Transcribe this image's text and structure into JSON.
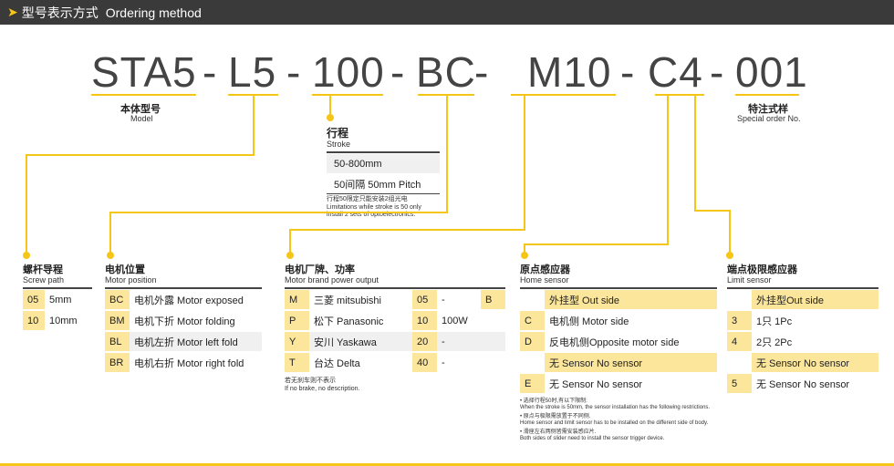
{
  "header": {
    "title_zh": "型号表示方式",
    "title_en": "Ordering method"
  },
  "code": {
    "p1": "STA5",
    "s1": "-",
    "p2": "L5",
    "s2": "-",
    "p3": "100",
    "s3": "-",
    "p4": "BC",
    "s4": "-",
    "p5": "M10",
    "s5": "-",
    "p6": "C4",
    "s6": "-",
    "p7": "001"
  },
  "model": {
    "zh": "本体型号",
    "en": "Model"
  },
  "special": {
    "zh": "特注式样",
    "en": "Special order No."
  },
  "stroke": {
    "zh": "行程",
    "en": "Stroke",
    "rows": [
      "50-800mm",
      "50间隔 50mm Pitch"
    ],
    "note1": "行程50限定只能安装2组光电",
    "note2": "Limitations while stroke is 50 only",
    "note3": "install 2 sets of optoelectronics."
  },
  "screw": {
    "zh": "螺杆导程",
    "en": "Screw path",
    "rows": [
      {
        "code": "05",
        "val": "5mm"
      },
      {
        "code": "10",
        "val": "10mm"
      }
    ]
  },
  "motorpos": {
    "zh": "电机位置",
    "en": "Motor position",
    "rows": [
      {
        "code": "BC",
        "val": "电机外露 Motor exposed"
      },
      {
        "code": "BM",
        "val": "电机下折 Motor folding"
      },
      {
        "code": "BL",
        "val": "电机左折 Motor left fold"
      },
      {
        "code": "BR",
        "val": "电机右折 Motor right fold"
      }
    ]
  },
  "brand": {
    "zh": "电机厂牌、功率",
    "en": "Motor brand   power output",
    "rows": [
      {
        "code": "M",
        "name": "三菱  mitsubishi",
        "p": "05",
        "w": "-",
        "b": "B"
      },
      {
        "code": "P",
        "name": "松下 Panasonic",
        "p": "10",
        "w": "100W",
        "b": ""
      },
      {
        "code": "Y",
        "name": "安川  Yaskawa",
        "p": "20",
        "w": "-",
        "b": ""
      },
      {
        "code": "T",
        "name": "台达  Delta",
        "p": "40",
        "w": "-",
        "b": ""
      }
    ],
    "note1": "若无刹车则不表示",
    "note2": "If no brake, no description."
  },
  "home": {
    "zh": "原点感应器",
    "en": "Home sensor",
    "rows": [
      {
        "code": "",
        "val": "外挂型 Out side"
      },
      {
        "code": "C",
        "val": "电机侧 Motor side"
      },
      {
        "code": "D",
        "val": "反电机侧Opposite motor side"
      },
      {
        "code": "",
        "val": "无 Sensor No sensor"
      },
      {
        "code": "E",
        "val": "无 Sensor No sensor"
      }
    ],
    "notes": [
      "• 选择行程50时,有以下限制:",
      "  When the stroke is 50mm,  the sensor installation has the following restrictions.",
      "• 原点与极限需放置于不同侧.",
      "  Home sensor and limit sensor has to be installed on the different side of body.",
      "• 滑座左右两侧皆需安装感应片.",
      "  Both sides of slider need to install the sensor trigger device."
    ]
  },
  "limit": {
    "zh": "端点极限感应器",
    "en": "Limit sensor",
    "rows": [
      {
        "code": "",
        "val": "外挂型Out side"
      },
      {
        "code": "3",
        "val": "1只 1Pc"
      },
      {
        "code": "4",
        "val": "2只 2Pc"
      },
      {
        "code": "",
        "val": "无 Sensor No sensor"
      },
      {
        "code": "5",
        "val": "无 Sensor No sensor"
      }
    ]
  }
}
